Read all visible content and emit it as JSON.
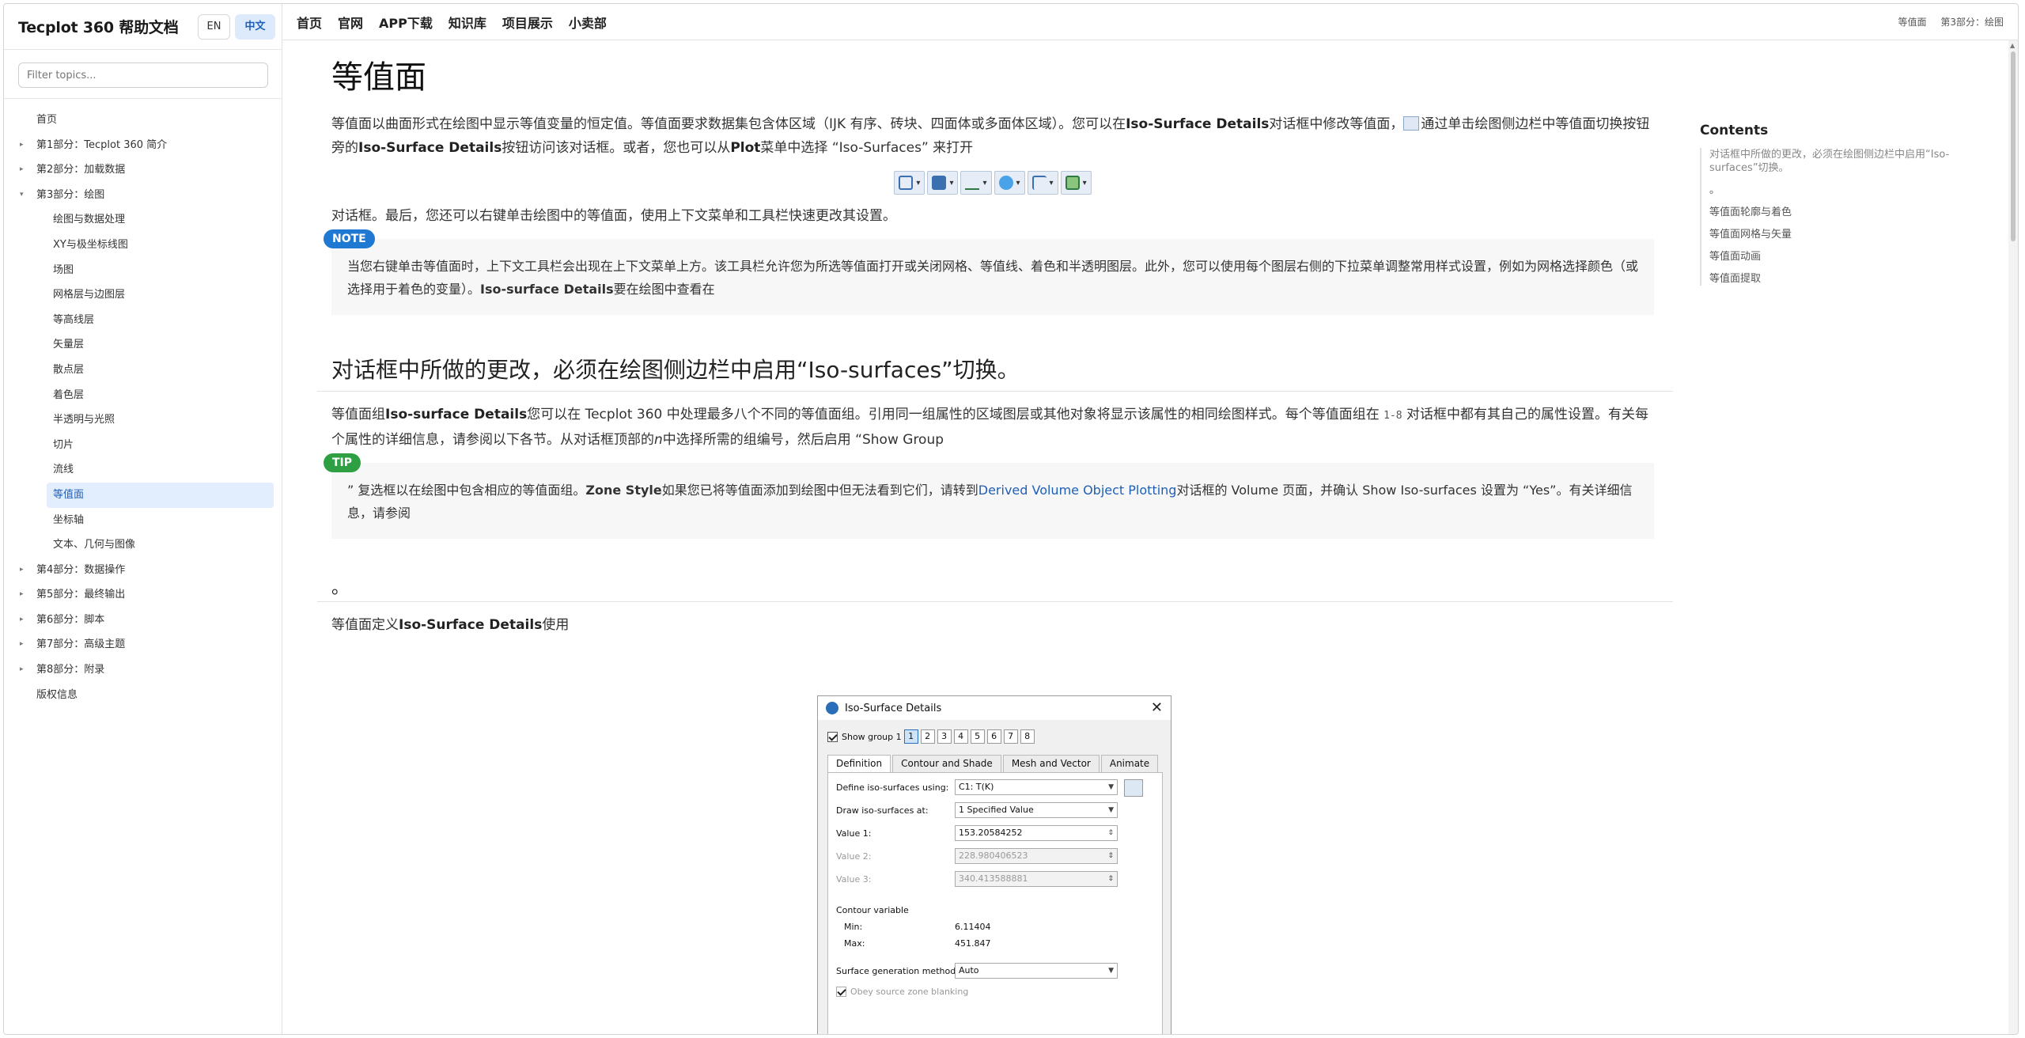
{
  "sidebar": {
    "title": "Tecplot 360 帮助文档",
    "lang": [
      "EN",
      "中文"
    ],
    "filter_placeholder": "Filter topics...",
    "items": [
      {
        "label": "首页",
        "level": 0,
        "caret": ""
      },
      {
        "label": "第1部分：Tecplot 360 简介",
        "level": 0,
        "caret": "▸"
      },
      {
        "label": "第2部分：加载数据",
        "level": 0,
        "caret": "▸"
      },
      {
        "label": "第3部分：绘图",
        "level": 0,
        "caret": "▾"
      },
      {
        "label": "绘图与数据处理",
        "level": 1,
        "caret": ""
      },
      {
        "label": "XY与极坐标线图",
        "level": 1,
        "caret": ""
      },
      {
        "label": "场图",
        "level": 1,
        "caret": ""
      },
      {
        "label": "网格层与边图层",
        "level": 1,
        "caret": ""
      },
      {
        "label": "等高线层",
        "level": 1,
        "caret": ""
      },
      {
        "label": "矢量层",
        "level": 1,
        "caret": ""
      },
      {
        "label": "散点层",
        "level": 1,
        "caret": ""
      },
      {
        "label": "着色层",
        "level": 1,
        "caret": ""
      },
      {
        "label": "半透明与光照",
        "level": 1,
        "caret": ""
      },
      {
        "label": "切片",
        "level": 1,
        "caret": ""
      },
      {
        "label": "流线",
        "level": 1,
        "caret": ""
      },
      {
        "label": "等值面",
        "level": 1,
        "caret": "",
        "selected": true
      },
      {
        "label": "坐标轴",
        "level": 1,
        "caret": ""
      },
      {
        "label": "文本、几何与图像",
        "level": 1,
        "caret": ""
      },
      {
        "label": "第4部分：数据操作",
        "level": 0,
        "caret": "▸"
      },
      {
        "label": "第5部分：最终输出",
        "level": 0,
        "caret": "▸"
      },
      {
        "label": "第6部分：脚本",
        "level": 0,
        "caret": "▸"
      },
      {
        "label": "第7部分：高级主题",
        "level": 0,
        "caret": "▸"
      },
      {
        "label": "第8部分：附录",
        "level": 0,
        "caret": "▸"
      },
      {
        "label": "版权信息",
        "level": 0,
        "caret": ""
      }
    ]
  },
  "nav": [
    "首页",
    "官网",
    "APP下载",
    "知识库",
    "项目展示",
    "小卖部"
  ],
  "breadcrumb": [
    "等值面",
    "第3部分：绘图"
  ],
  "article": {
    "title": "等值面",
    "p1": {
      "a": "等值面以曲面形式在绘图中显示等值变量的恒定值。等值面要求数据集包含体区域（IJK 有序、砖块、四面体或多面体区域）。您可以在",
      "b1": "Iso-Surface Details",
      "c": "对话框中修改等值面，",
      "d": "通过单击绘图侧边栏中等值面切换按钮旁的",
      "b2": "Iso-Surface Details",
      "e": "按钮访问该对话框。或者，您也可以从",
      "b3": "Plot",
      "f": "菜单中选择 “Iso-Surfaces” 来打开"
    },
    "p2": "对话框。最后，您还可以右键单击绘图中的等值面，使用上下文菜单和工具栏快速更改其设置。",
    "note_badge": "NOTE",
    "note": {
      "a": "当您右键单击等值面时，上下文工具栏会出现在上下文菜单上方。该工具栏允许您为所选等值面打开或关闭网格、等值线、着色和半透明图层。此外，您可以使用每个图层右侧的下拉菜单调整常用样式设置，例如为网格选择颜色（或选择用于着色的变量）。",
      "b": "Iso-surface Details",
      "c": "要在绘图中查看在"
    },
    "h2": "对话框中所做的更改，必须在绘图侧边栏中启用“Iso-surfaces”切换。",
    "p3": {
      "a": "等值面组",
      "b": "Iso-surface Details",
      "c": "您可以在 Tecplot 360 中处理最多八个不同的等值面组。引用同一组属性的区域图层或其他对象将显示该属性的相同绘图样式。每个等值面组在 ",
      "code": "1-8",
      "d": " 对话框中都有其自己的属性设置。有关每个属性的详细信息，请参阅以下各节。从对话框顶部的",
      "i": "n",
      "e": "中选择所需的组编号，然后启用 “Show Group"
    },
    "tip_badge": "TIP",
    "tip": {
      "a": "” 复选框以在绘图中包含相应的等值面组。",
      "b": "Zone Style",
      "c": "如果您已将等值面添加到绘图中但无法看到它们，请转到",
      "link": "Derived Volume Object Plotting",
      "d": "对话框的 Volume 页面，并确认 Show Iso-surfaces 设置为 “Yes”。有关详细信息，请参阅"
    },
    "h2b": "。",
    "p4": {
      "a": "等值面定义",
      "b": "Iso-Surface Details",
      "c": "使用"
    }
  },
  "toc": {
    "title": "Contents",
    "items": [
      "对话框中所做的更改，必须在绘图侧边栏中启用“Iso-surfaces”切换。",
      "。",
      "等值面轮廓与着色",
      "等值面网格与矢量",
      "等值面动画",
      "等值面提取"
    ]
  },
  "dialog": {
    "title": "Iso-Surface Details",
    "close": "✕",
    "show_group": "Show group 1",
    "groups": [
      "1",
      "2",
      "3",
      "4",
      "5",
      "6",
      "7",
      "8"
    ],
    "tabs": [
      "Definition",
      "Contour and Shade",
      "Mesh and Vector",
      "Animate"
    ],
    "define_label": "Define iso-surfaces using:",
    "define_value": "C1: T(K)",
    "draw_label": "Draw iso-surfaces at:",
    "draw_value": "1 Specified Value",
    "v1_label": "Value 1:",
    "v1": "153.20584252",
    "v2_label": "Value 2:",
    "v2": "228.980406523",
    "v3_label": "Value 3:",
    "v3": "340.413588881",
    "contour_var": "Contour variable",
    "min_label": "Min:",
    "min": "6.11404",
    "max_label": "Max:",
    "max": "451.847",
    "method_label": "Surface generation method:",
    "method_value": "Auto",
    "obey": "Obey source zone blanking"
  },
  "toolbar_icons": [
    "mesh-icon",
    "contour-icon",
    "vector-icon",
    "shade-icon",
    "edge-icon",
    "translucency-icon"
  ]
}
